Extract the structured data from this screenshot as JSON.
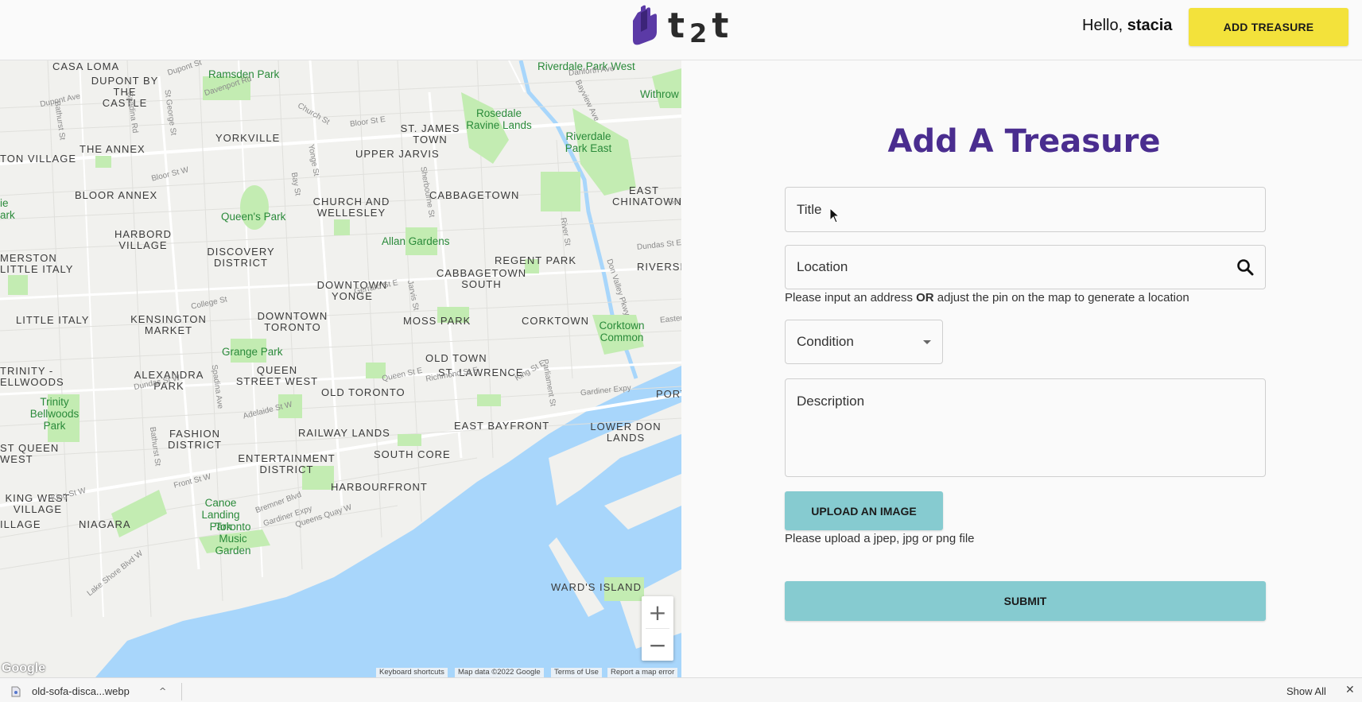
{
  "header": {
    "logo_text_a": "t",
    "logo_text_b": "2",
    "logo_text_c": "t",
    "greeting_prefix": "Hello, ",
    "username": "stacia",
    "add_treasure_label": "ADD TREASURE"
  },
  "map": {
    "neighbourhoods": [
      "CASA LOMA",
      "DUPONT BY THE CASTLE",
      "YORKVILLE",
      "ST. JAMES TOWN",
      "UPPER JARVIS",
      "THE ANNEX",
      "TON VILLAGE",
      "BLOOR ANNEX",
      "CHURCH AND WELLESLEY",
      "CABBAGETOWN",
      "EAST CHINATOWN",
      "HARBORD VILLAGE",
      "DISCOVERY DISTRICT",
      "REGENT PARK",
      "RIVERSI",
      "MERSTON",
      "LITTLE ITALY",
      "DOWNTOWN YONGE",
      "CABBAGETOWN SOUTH",
      "LITTLE ITALY",
      "KENSINGTON MARKET",
      "DOWNTOWN TORONTO",
      "MOSS PARK",
      "CORKTOWN",
      "OLD TOWN",
      "ST. LAWRENCE",
      "TRINITY - ELLWOODS",
      "ALEXANDRA PARK",
      "QUEEN STREET WEST",
      "OLD TORONTO",
      "PORT",
      "EAST BAYFRONT",
      "LOWER DON LANDS",
      "FASHION DISTRICT",
      "RAILWAY LANDS",
      "ST QUEEN WEST",
      "ENTERTAINMENT DISTRICT",
      "SOUTH CORE",
      "HARBOURFRONT",
      "KING WEST VILLAGE",
      "ILLAGE",
      "NIAGARA",
      "WARD'S ISLAND"
    ],
    "parks": [
      "Ramsden Park",
      "Rosedale Ravine Lands",
      "Riverdale Park East",
      "Withrow",
      "Queen's Park",
      "Riverdale Park West",
      "Allan Gardens",
      "Corktown Common",
      "Grange Park",
      "Trinity Bellwoods Park",
      "Canoe Landing Park",
      "Toronto Music Garden",
      "ie ark"
    ],
    "streets": [
      "Dupont St",
      "Davenport Rd",
      "Bloor St E",
      "Bloor St W",
      "Church St",
      "Yonge St",
      "Bay St",
      "Sherbourne St",
      "River St",
      "Dundas St E",
      "Gerrard St E",
      "College St",
      "Jarvis St",
      "Queen St E",
      "Richmond St E",
      "King St E",
      "Parliament St",
      "Don Valley Pkwy",
      "Dundas St W",
      "Spadina Ave",
      "Adelaide St W",
      "Bathurst St",
      "King St W",
      "Front St W",
      "Bremner Blvd",
      "Gardiner Expy",
      "Queens Quay W",
      "Lake Shore Blvd W",
      "Eastern",
      "Gardiner Expy",
      "St George St",
      "Spadina Rd",
      "Bathurst St",
      "Dupont Ave",
      "Danforth Ave",
      "Bayview Ave",
      "Gerr"
    ],
    "zoom_in": "+",
    "zoom_out": "−",
    "google_logo": "Google",
    "attribution": [
      "Keyboard shortcuts",
      "Map data ©2022 Google",
      "Terms of Use",
      "Report a map error"
    ]
  },
  "form": {
    "heading": "Add A Treasure",
    "title_placeholder": "Title",
    "location_placeholder": "Location",
    "location_hint_a": "Please input an address ",
    "location_hint_b": "OR",
    "location_hint_c": " adjust the pin on the map to generate a location",
    "condition_label": "Condition",
    "description_placeholder": "Description",
    "upload_label": "UPLOAD AN IMAGE",
    "upload_hint": "Please upload a jpep, jpg or png file",
    "submit_label": "SUBMIT"
  },
  "download_bar": {
    "file_name": "old-sofa-disca...webp",
    "chevron": "^",
    "show_all": "Show All",
    "close": "✕"
  },
  "colors": {
    "brand_purple": "#4a2d8f",
    "add_button_yellow": "#f3e23b",
    "action_teal": "#86cbd0",
    "water": "#a8d6fb",
    "park_green": "#c3ecb2"
  }
}
